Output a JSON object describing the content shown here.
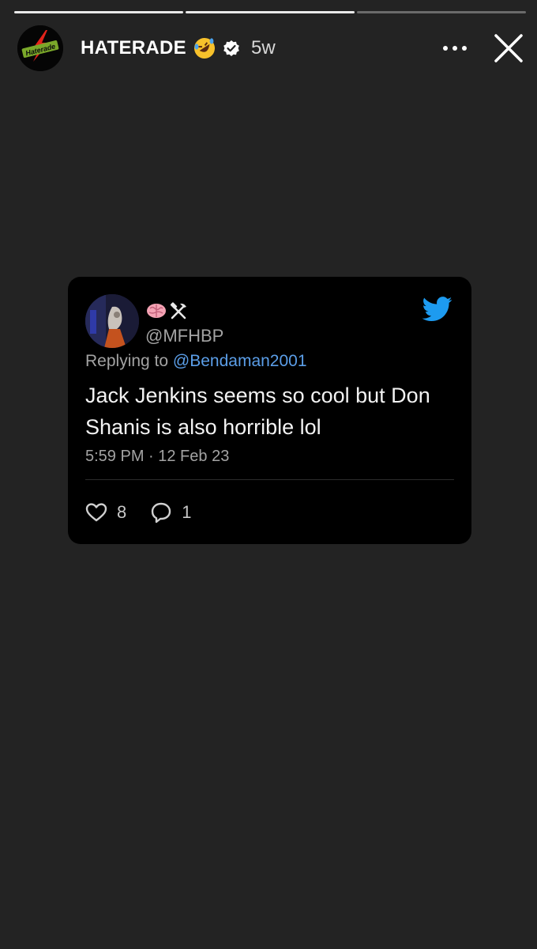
{
  "story": {
    "segments_total": 3,
    "segments_done": 2,
    "account": {
      "username": "HATERADE",
      "logo_icon": "haterade-bolt-logo-icon",
      "status_emoji": "rolling-on-floor-laughing-emoji",
      "verified": true,
      "posted_ago": "5w"
    },
    "controls": {
      "more_icon": "more-horizontal-icon",
      "close_icon": "close-icon"
    }
  },
  "tweet": {
    "display_name_emojis": [
      "brain-emoji",
      "hammer-and-pick-emoji"
    ],
    "handle": "@MFHBP",
    "reply_prefix": "Replying to",
    "reply_to": "@Bendaman2001",
    "text": "Jack Jenkins seems so cool but Don Shanis is also horrible lol",
    "timestamp": "5:59 PM · 12 Feb 23",
    "likes": "8",
    "replies": "1",
    "brand_icon": "twitter-bird-icon",
    "colors": {
      "card_bg": "#000000",
      "mention": "#5b9ee8",
      "bird": "#1d9bf0",
      "page_bg": "#232323"
    }
  }
}
